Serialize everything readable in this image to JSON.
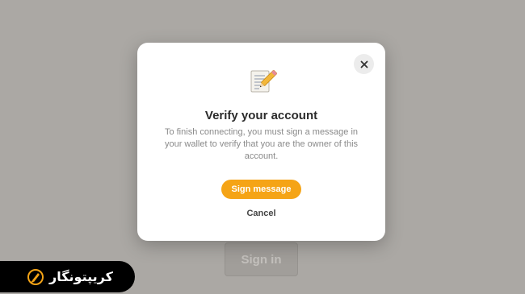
{
  "background": {
    "sign_in_label": "Sign in"
  },
  "modal": {
    "title": "Verify your account",
    "description": "To finish connecting, you must sign a message in your wallet to verify that you are the owner of this account.",
    "primary_button_label": "Sign message",
    "cancel_label": "Cancel",
    "close_icon": "close-icon",
    "header_icon": "document-pencil-icon"
  },
  "watermark": {
    "brand_text": "کریپتونگار",
    "logo_icon": "bitcoin-pen-logo"
  },
  "colors": {
    "backdrop": "#aba8a4",
    "accent": "#f5a416",
    "modal_bg": "#ffffff",
    "badge_bg": "#000000"
  }
}
